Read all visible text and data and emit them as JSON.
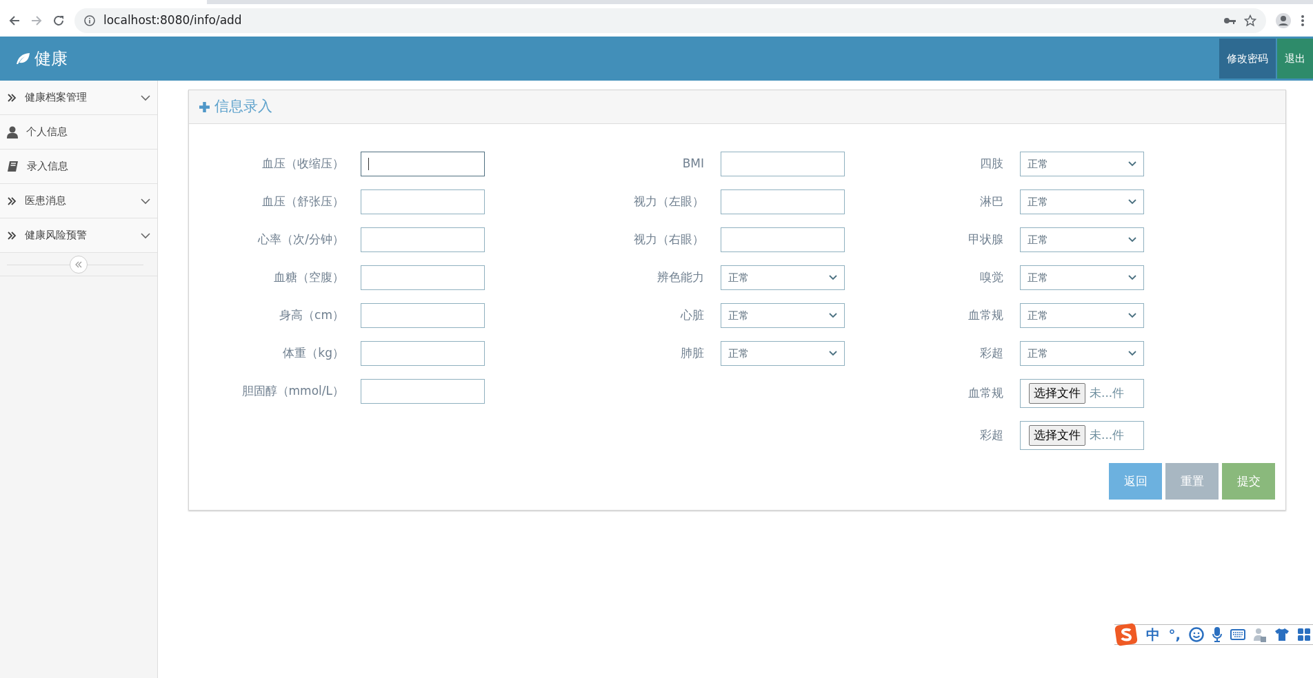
{
  "browser": {
    "url": "localhost:8080/info/add"
  },
  "header": {
    "brand": "健康",
    "buttons": [
      {
        "label": "修改密码",
        "color": "#2e6a91"
      },
      {
        "label": "退出",
        "color": "#2e8b6a"
      }
    ]
  },
  "sidebar": {
    "items": [
      {
        "label": "健康档案管理",
        "kind": "group"
      },
      {
        "label": "个人信息",
        "kind": "profile"
      },
      {
        "label": "录入信息",
        "kind": "entry"
      },
      {
        "label": "医患消息",
        "kind": "group"
      },
      {
        "label": "健康风险预警",
        "kind": "group"
      }
    ]
  },
  "panel": {
    "title": "信息录入",
    "columns": [
      [
        {
          "label": "血压（收缩压）",
          "kind": "text",
          "focused": true
        },
        {
          "label": "血压（舒张压）",
          "kind": "text",
          "focused": false
        },
        {
          "label": "心率（次/分钟）",
          "kind": "text",
          "focused": false
        },
        {
          "label": "血糖（空腹）",
          "kind": "text",
          "focused": false
        },
        {
          "label": "身高（cm）",
          "kind": "text",
          "focused": false
        },
        {
          "label": "体重（kg）",
          "kind": "text",
          "focused": false
        },
        {
          "label": "胆固醇（mmol/L）",
          "kind": "text",
          "focused": false
        }
      ],
      [
        {
          "label": "BMI",
          "kind": "text",
          "focused": false
        },
        {
          "label": "视力（左眼）",
          "kind": "text",
          "focused": false
        },
        {
          "label": "视力（右眼）",
          "kind": "text",
          "focused": false
        },
        {
          "label": "辨色能力",
          "kind": "select",
          "value": "正常"
        },
        {
          "label": "心脏",
          "kind": "select",
          "value": "正常"
        },
        {
          "label": "肺脏",
          "kind": "select",
          "value": "正常"
        }
      ],
      [
        {
          "label": "四肢",
          "kind": "select",
          "value": "正常"
        },
        {
          "label": "淋巴",
          "kind": "select",
          "value": "正常"
        },
        {
          "label": "甲状腺",
          "kind": "select",
          "value": "正常"
        },
        {
          "label": "嗅觉",
          "kind": "select",
          "value": "正常"
        },
        {
          "label": "血常规",
          "kind": "select",
          "value": "正常"
        },
        {
          "label": "彩超",
          "kind": "select",
          "value": "正常"
        },
        {
          "label": "血常规",
          "kind": "file",
          "button": "选择文件",
          "status": "未...件"
        },
        {
          "label": "彩超",
          "kind": "file",
          "button": "选择文件",
          "status": "未...件"
        }
      ]
    ],
    "actions": [
      {
        "label": "返回",
        "color": "#6cb1df"
      },
      {
        "label": "重置",
        "color": "#a8b7c2"
      },
      {
        "label": "提交",
        "color": "#8ab97c"
      }
    ]
  },
  "ime_bar": {
    "mode": "中",
    "punctuation": "°,"
  }
}
